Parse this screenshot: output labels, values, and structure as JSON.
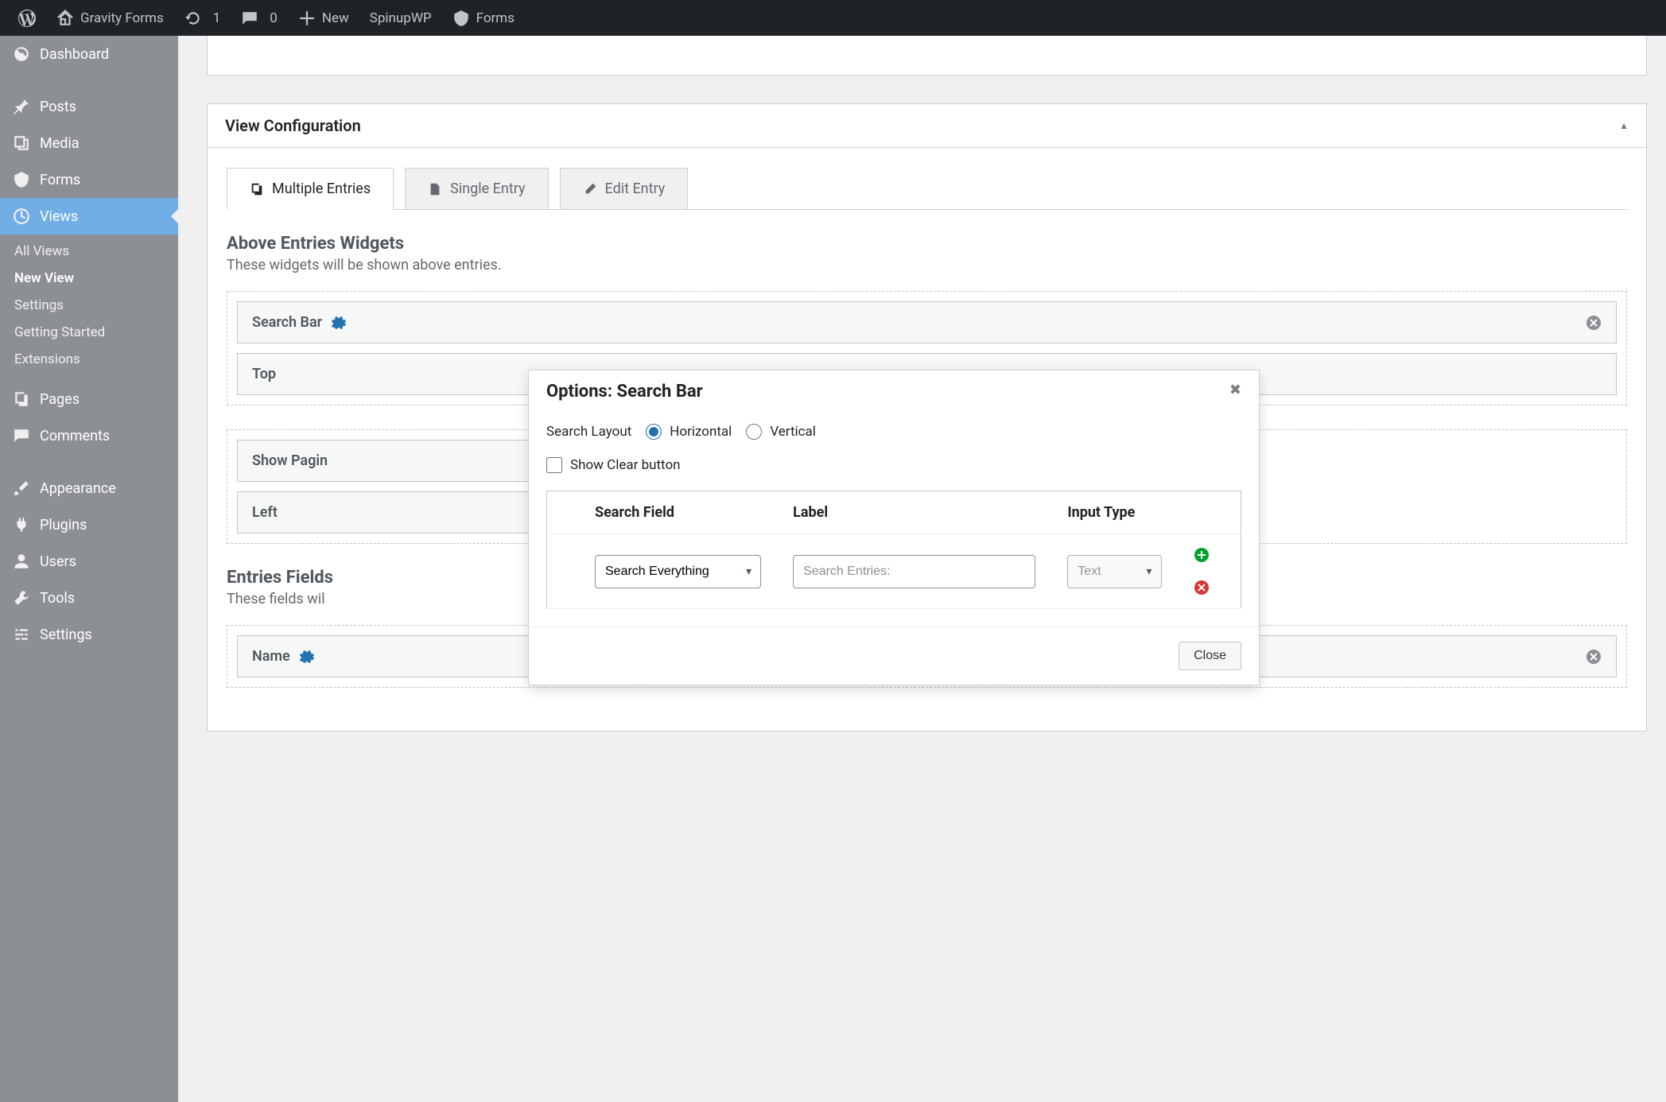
{
  "admin_bar": {
    "site_name": "Gravity Forms",
    "updates_count": "1",
    "comments_count": "0",
    "new_label": "New",
    "spinupwp_label": "SpinupWP",
    "forms_label": "Forms"
  },
  "sidebar": {
    "items": [
      {
        "label": "Dashboard"
      },
      {
        "label": "Posts"
      },
      {
        "label": "Media"
      },
      {
        "label": "Forms"
      },
      {
        "label": "Views"
      },
      {
        "label": "Pages"
      },
      {
        "label": "Comments"
      },
      {
        "label": "Appearance"
      },
      {
        "label": "Plugins"
      },
      {
        "label": "Users"
      },
      {
        "label": "Tools"
      },
      {
        "label": "Settings"
      }
    ],
    "submenu": [
      {
        "label": "All Views"
      },
      {
        "label": "New View"
      },
      {
        "label": "Settings"
      },
      {
        "label": "Getting Started"
      },
      {
        "label": "Extensions"
      }
    ]
  },
  "panel": {
    "title": "View Configuration",
    "tabs": [
      {
        "label": "Multiple Entries"
      },
      {
        "label": "Single Entry"
      },
      {
        "label": "Edit Entry"
      }
    ],
    "above_widgets": {
      "title": "Above Entries Widgets",
      "desc": "These widgets will be shown above entries.",
      "widget_name": "Search Bar",
      "zones": {
        "top": "Top",
        "left": "Left",
        "pagination": "Show Pagin"
      }
    },
    "entries_fields": {
      "title": "Entries Fields",
      "desc": "These fields wil",
      "field_name": "Name"
    }
  },
  "modal": {
    "title": "Options: Search Bar",
    "layout_label": "Search Layout",
    "layout_options": {
      "horizontal": "Horizontal",
      "vertical": "Vertical"
    },
    "clear_label": "Show Clear button",
    "table": {
      "headers": {
        "field": "Search Field",
        "label": "Label",
        "type": "Input Type"
      },
      "rows": [
        {
          "field": "Search Everything",
          "label_placeholder": "Search Entries:",
          "type": "Text"
        }
      ]
    },
    "close_btn": "Close"
  }
}
